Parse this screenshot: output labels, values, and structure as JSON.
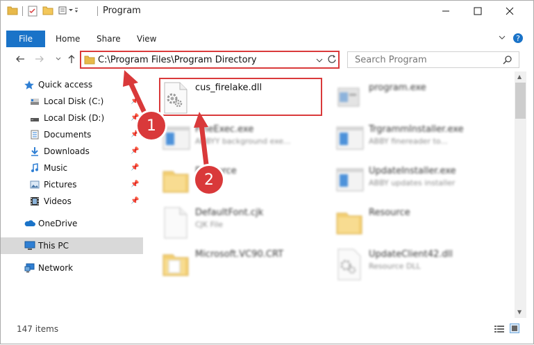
{
  "window": {
    "title": "Program"
  },
  "ribbon": {
    "tabs": [
      {
        "label": "File"
      },
      {
        "label": "Home"
      },
      {
        "label": "Share"
      },
      {
        "label": "View"
      }
    ]
  },
  "address": {
    "path": "C:\\Program Files\\Program Directory",
    "search_placeholder": "Search Program"
  },
  "sidebar": {
    "items": [
      {
        "label": "Quick access",
        "icon": "star-icon"
      },
      {
        "label": "Local Disk (C:)",
        "icon": "drive-icon",
        "pinned": true
      },
      {
        "label": "Local Disk (D:)",
        "icon": "drive-icon",
        "pinned": true
      },
      {
        "label": "Documents",
        "icon": "documents-icon",
        "pinned": true
      },
      {
        "label": "Downloads",
        "icon": "download-icon",
        "pinned": true
      },
      {
        "label": "Music",
        "icon": "music-icon",
        "pinned": true
      },
      {
        "label": "Pictures",
        "icon": "pictures-icon",
        "pinned": true
      },
      {
        "label": "Videos",
        "icon": "videos-icon",
        "pinned": true
      },
      {
        "label": "OneDrive",
        "icon": "cloud-icon"
      },
      {
        "label": "This PC",
        "icon": "computer-icon",
        "selected": true
      },
      {
        "label": "Network",
        "icon": "network-icon"
      }
    ]
  },
  "files": [
    {
      "name": "cus_firelake.dll",
      "desc": "",
      "icon": "dll-gear-icon"
    },
    {
      "name": "program.exe",
      "desc": "",
      "icon": "exe-icon"
    },
    {
      "name": "FineExec.exe",
      "desc": "ABBYY background exe...",
      "icon": "window-exe-icon"
    },
    {
      "name": "TrgrammInstaller.exe",
      "desc": "ABBY finereader to...",
      "icon": "window-exe-icon"
    },
    {
      "name": "Resource",
      "desc": "",
      "icon": "folder-icon"
    },
    {
      "name": "UpdateInstaller.exe",
      "desc": "ABBY updates installer",
      "icon": "window-exe-icon"
    },
    {
      "name": "DefaultFont.cjk",
      "desc": "CJK File",
      "icon": "blank-file-icon"
    },
    {
      "name": "Resource",
      "desc": "",
      "icon": "folder-icon"
    },
    {
      "name": "Microsoft.VC90.CRT",
      "desc": "",
      "icon": "folder-icon"
    },
    {
      "name": "UpdateClient42.dll",
      "desc": "Resource DLL",
      "icon": "dll-gear-icon"
    }
  ],
  "annotations": {
    "step1": "1",
    "step2": "2"
  },
  "status": {
    "count": "147 items"
  },
  "colors": {
    "accent": "#1a73c8",
    "annotation": "#d9393a",
    "selected_bg": "#d9d9d9"
  }
}
